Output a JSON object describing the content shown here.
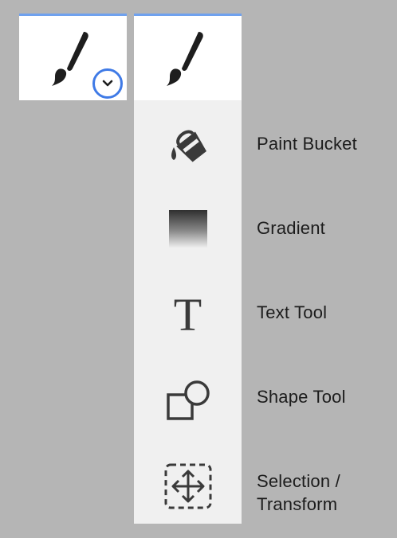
{
  "toolbar": {
    "active_tool": {
      "icon": "paint-brush-icon",
      "dropdown_icon": "chevron-down-icon"
    },
    "flyout": {
      "header_icon": "paint-brush-icon",
      "items": [
        {
          "label": "Paint Bucket",
          "icon": "paint-bucket-icon"
        },
        {
          "label": "Gradient",
          "icon": "gradient-icon"
        },
        {
          "label": "Text Tool",
          "icon": "text-tool-icon",
          "glyph": "T"
        },
        {
          "label": "Shape Tool",
          "icon": "shape-tool-icon"
        },
        {
          "label": "Selection /",
          "label_line2": "Transform",
          "icon": "selection-transform-icon"
        }
      ]
    }
  },
  "colors": {
    "background": "#b5b5b5",
    "button": "#ffffff",
    "flyout": "#f0f0f0",
    "accent_top": "#6fa1ee",
    "focus_ring": "#3f7ae6",
    "icon": "#1e1e1e"
  }
}
